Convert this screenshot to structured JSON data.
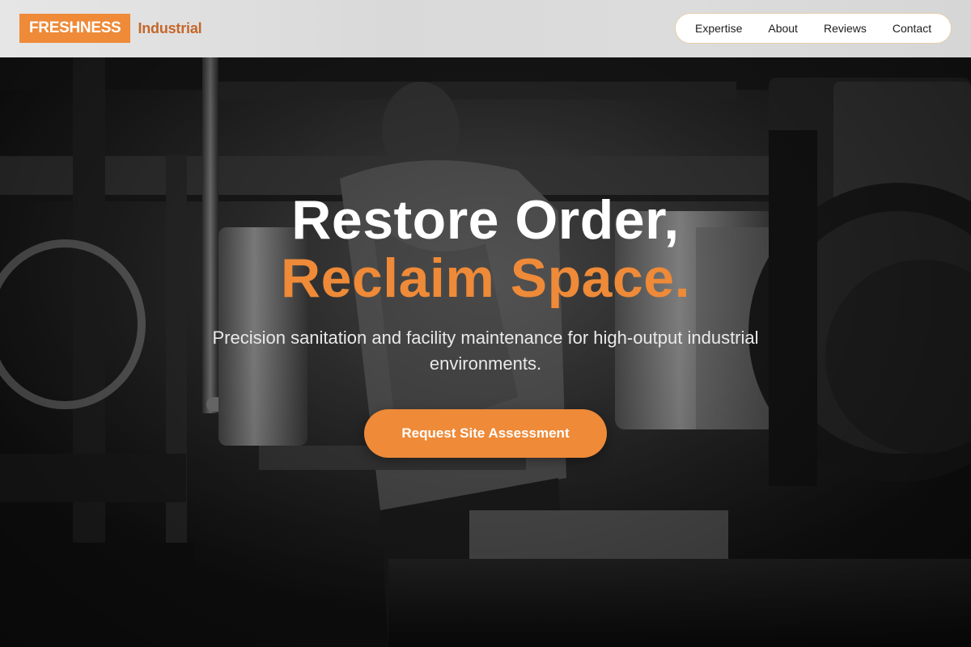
{
  "brand": {
    "name": "FRESHNESS",
    "tagline": "Industrial",
    "accent_color": "#ee8a38"
  },
  "nav": {
    "items": [
      {
        "label": "Expertise"
      },
      {
        "label": "About"
      },
      {
        "label": "Reviews"
      },
      {
        "label": "Contact"
      }
    ]
  },
  "hero": {
    "title_line1": "Restore Order,",
    "title_line2": "Reclaim Space.",
    "subtitle": "Precision sanitation and facility maintenance for high-output industrial environments.",
    "cta_label": "Request Site Assessment",
    "background": "monochrome photo of a worker operating industrial machinery"
  }
}
